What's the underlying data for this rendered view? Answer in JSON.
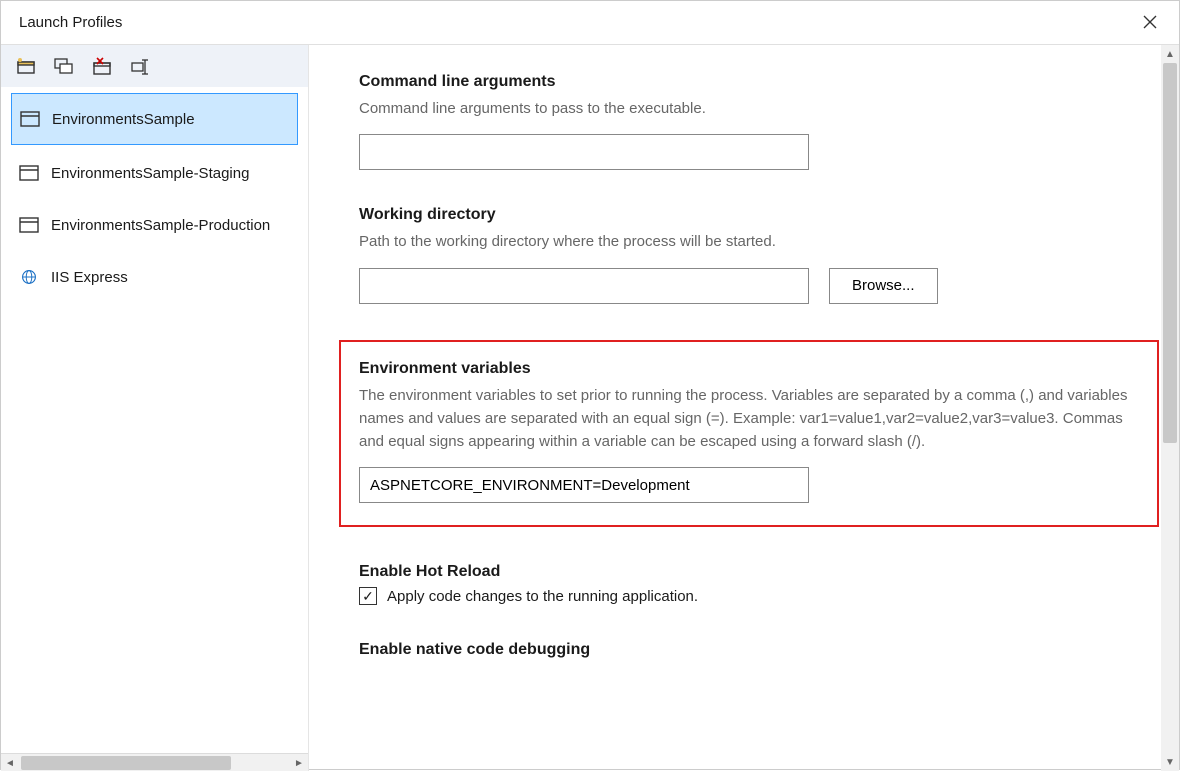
{
  "window": {
    "title": "Launch Profiles"
  },
  "toolbar": {
    "icons": [
      "new-profile",
      "duplicate-profile",
      "delete-profile",
      "rename-profile"
    ]
  },
  "profiles": [
    {
      "label": "EnvironmentsSample",
      "icon": "window",
      "selected": true
    },
    {
      "label": "EnvironmentsSample-Staging",
      "icon": "window",
      "selected": false
    },
    {
      "label": "EnvironmentsSample-Production",
      "icon": "window",
      "selected": false
    },
    {
      "label": "IIS Express",
      "icon": "globe",
      "selected": false
    }
  ],
  "sections": {
    "cmdline": {
      "title": "Command line arguments",
      "desc": "Command line arguments to pass to the executable.",
      "value": ""
    },
    "workdir": {
      "title": "Working directory",
      "desc": "Path to the working directory where the process will be started.",
      "value": "",
      "browse_label": "Browse..."
    },
    "envvars": {
      "title": "Environment variables",
      "desc": "The environment variables to set prior to running the process. Variables are separated by a comma (,) and variables names and values are separated with an equal sign (=). Example: var1=value1,var2=value2,var3=value3. Commas and equal signs appearing within a variable can be escaped using a forward slash (/).",
      "value": "ASPNETCORE_ENVIRONMENT=Development"
    },
    "hotreload": {
      "title": "Enable Hot Reload",
      "checkbox_label": "Apply code changes to the running application.",
      "checked": true
    },
    "nativedebug": {
      "title": "Enable native code debugging"
    }
  }
}
